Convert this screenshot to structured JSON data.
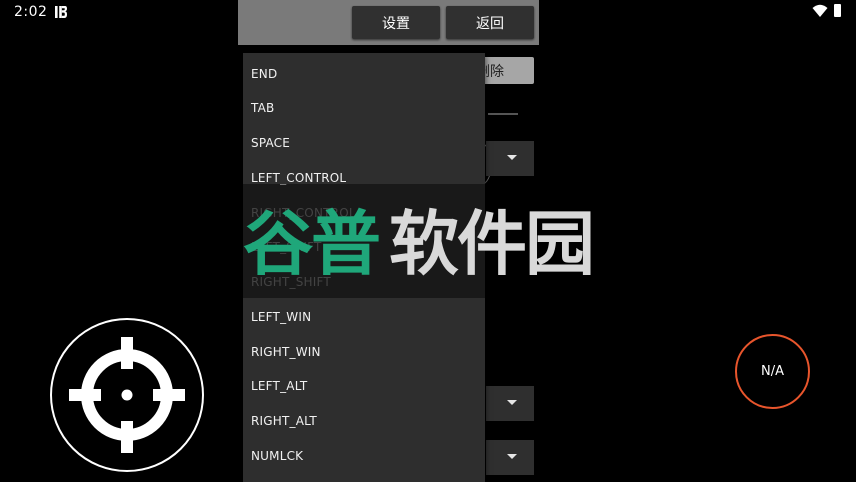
{
  "status_bar": {
    "time": "2:02",
    "app_icon": "notification-app-icon",
    "wifi_icon": "wifi-icon",
    "battery_icon": "battery-icon"
  },
  "panel": {
    "settings_label": "设置",
    "back_label": "返回",
    "delete_label": "删除",
    "overlay_caption": "谷普软件园"
  },
  "dropdown": {
    "items": [
      {
        "label": "END",
        "faded": false
      },
      {
        "label": "TAB",
        "faded": false
      },
      {
        "label": "SPACE",
        "faded": false
      },
      {
        "label": "LEFT_CONTROL",
        "faded": false
      },
      {
        "label": "RIGHT_CONTROL",
        "faded": true
      },
      {
        "label": "LEFT_SHIFT",
        "faded": true
      },
      {
        "label": "RIGHT_SHIFT",
        "faded": true
      },
      {
        "label": "LEFT_WIN",
        "faded": false
      },
      {
        "label": "RIGHT_WIN",
        "faded": false
      },
      {
        "label": "LEFT_ALT",
        "faded": false
      },
      {
        "label": "RIGHT_ALT",
        "faded": false
      },
      {
        "label": "NUMLCK",
        "faded": false
      }
    ]
  },
  "controls": {
    "aim_icon": "crosshair-icon",
    "right_button_label": "N/A",
    "right_button_color": "#e8552c"
  },
  "colors": {
    "watermark_green": "#1fa77a",
    "watermark_gray": "#d9d9d9",
    "panel_header": "#7a7a7a",
    "button_bg": "#303030"
  }
}
